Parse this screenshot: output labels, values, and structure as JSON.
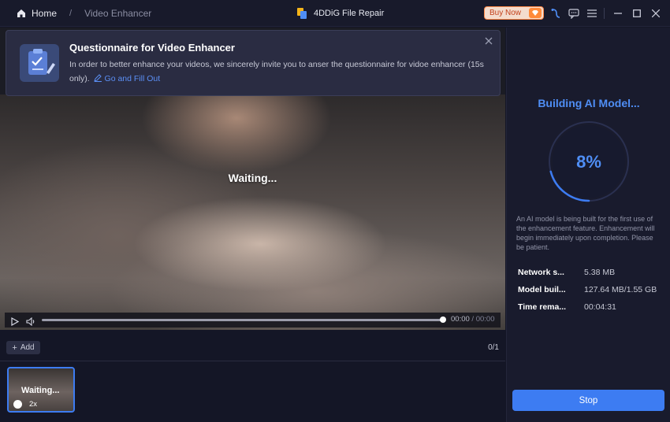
{
  "titlebar": {
    "home_label": "Home",
    "separator": "/",
    "page_label": "Video Enhancer",
    "app_title": "4DDiG File Repair",
    "buy_now_label": "Buy Now"
  },
  "icons": {
    "home": "home-icon",
    "app_logo": "app-logo-icon",
    "gem": "gem-icon",
    "support": "support-icon",
    "feedback": "feedback-icon",
    "menu": "menu-icon",
    "minimize": "minimize-icon",
    "maximize": "maximize-icon",
    "close": "close-icon"
  },
  "questionnaire": {
    "title": "Questionnaire for Video Enhancer",
    "body": "In order to better enhance your videos, we sincerely invite you to anser the questionnaire for vidoe enhancer (15s only).",
    "link_label": "Go and Fill Out"
  },
  "preview": {
    "status": "Waiting...",
    "current_time": "00:00",
    "total_time": "/ 00:00"
  },
  "list": {
    "add_label": "Add",
    "count": "0/1",
    "items": [
      {
        "status": "Waiting...",
        "scale": "2x"
      }
    ]
  },
  "model": {
    "heading": "Building AI Model...",
    "percent": "8%",
    "progress": 0.08,
    "description": "An AI model is being built for the first use of the enhancement feature. Enhancement will begin immediately upon completion. Please be patient.",
    "stats": [
      {
        "key": "Network s...",
        "value": "5.38 MB"
      },
      {
        "key": "Model buil...",
        "value": "127.64 MB/1.55 GB"
      },
      {
        "key": "Time rema...",
        "value": "00:04:31"
      }
    ],
    "stop_label": "Stop"
  },
  "colors": {
    "accent": "#3d7cf2",
    "accent_text": "#4f8ef5",
    "background": "#141626",
    "panel": "#191b2d"
  }
}
